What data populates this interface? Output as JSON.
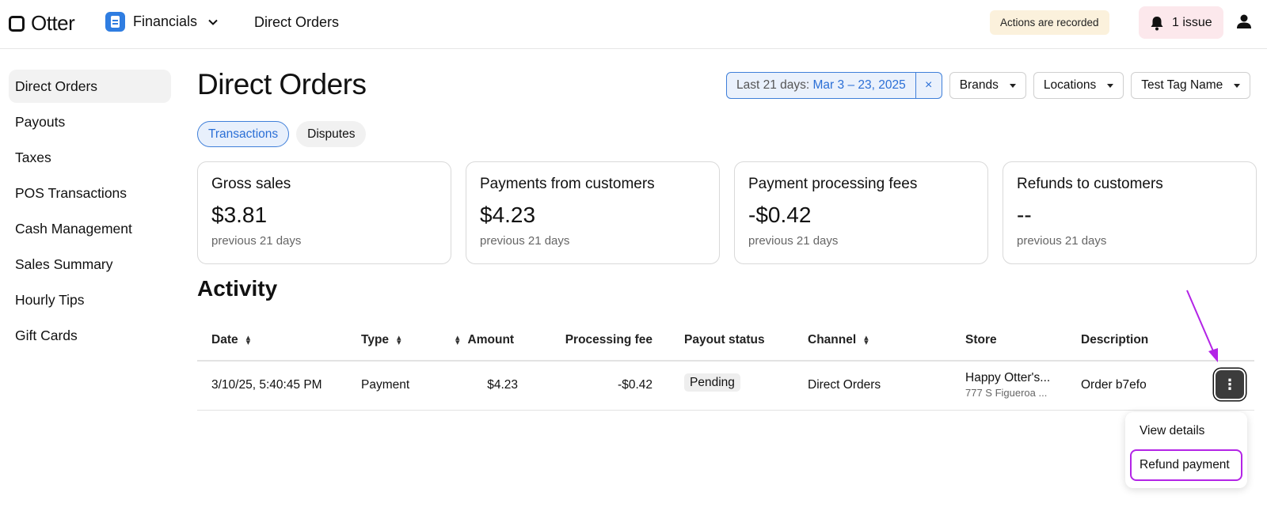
{
  "header": {
    "logo_text": "Otter",
    "app_name": "Financials",
    "page_title": "Direct Orders",
    "recorded_badge": "Actions are recorded",
    "issue_label": "1 issue"
  },
  "sidebar": {
    "items": [
      {
        "label": "Direct Orders"
      },
      {
        "label": "Payouts"
      },
      {
        "label": "Taxes"
      },
      {
        "label": "POS Transactions"
      },
      {
        "label": "Cash Management"
      },
      {
        "label": "Sales Summary"
      },
      {
        "label": "Hourly Tips"
      },
      {
        "label": "Gift Cards"
      }
    ]
  },
  "main": {
    "title": "Direct Orders",
    "date_filter": {
      "prefix": "Last 21 days:",
      "value": "Mar 3 – 23, 2025",
      "clear_icon": "×"
    },
    "filters": [
      {
        "label": "Brands"
      },
      {
        "label": "Locations"
      },
      {
        "label": "Test Tag Name"
      }
    ],
    "tabs": [
      {
        "label": "Transactions",
        "active": true
      },
      {
        "label": "Disputes",
        "active": false
      }
    ],
    "cards": [
      {
        "title": "Gross sales",
        "value": "$3.81",
        "sub": "previous 21 days"
      },
      {
        "title": "Payments from customers",
        "value": "$4.23",
        "sub": "previous 21 days"
      },
      {
        "title": "Payment processing fees",
        "value": "-$0.42",
        "sub": "previous 21 days"
      },
      {
        "title": "Refunds to customers",
        "value": "--",
        "sub": "previous 21 days"
      }
    ],
    "activity_title": "Activity"
  },
  "table": {
    "columns": [
      {
        "label": "Date"
      },
      {
        "label": "Type"
      },
      {
        "label": "Amount"
      },
      {
        "label": "Processing fee"
      },
      {
        "label": "Payout status"
      },
      {
        "label": "Channel"
      },
      {
        "label": "Store"
      },
      {
        "label": "Description"
      }
    ],
    "rows": [
      {
        "date": "3/10/25, 5:40:45 PM",
        "type": "Payment",
        "amount": "$4.23",
        "fee": "-$0.42",
        "status": "Pending",
        "channel": "Direct Orders",
        "store_name": "Happy Otter's...",
        "store_addr": "777 S Figueroa ...",
        "description": "Order b7efo"
      }
    ]
  },
  "row_menu": {
    "items": [
      {
        "label": "View details"
      },
      {
        "label": "Refund payment"
      }
    ]
  },
  "colors": {
    "accent": "#2b6fd6",
    "highlight": "#b324e6",
    "recorded_bg": "#fbf1dc",
    "issue_bg": "#fce8ec"
  }
}
